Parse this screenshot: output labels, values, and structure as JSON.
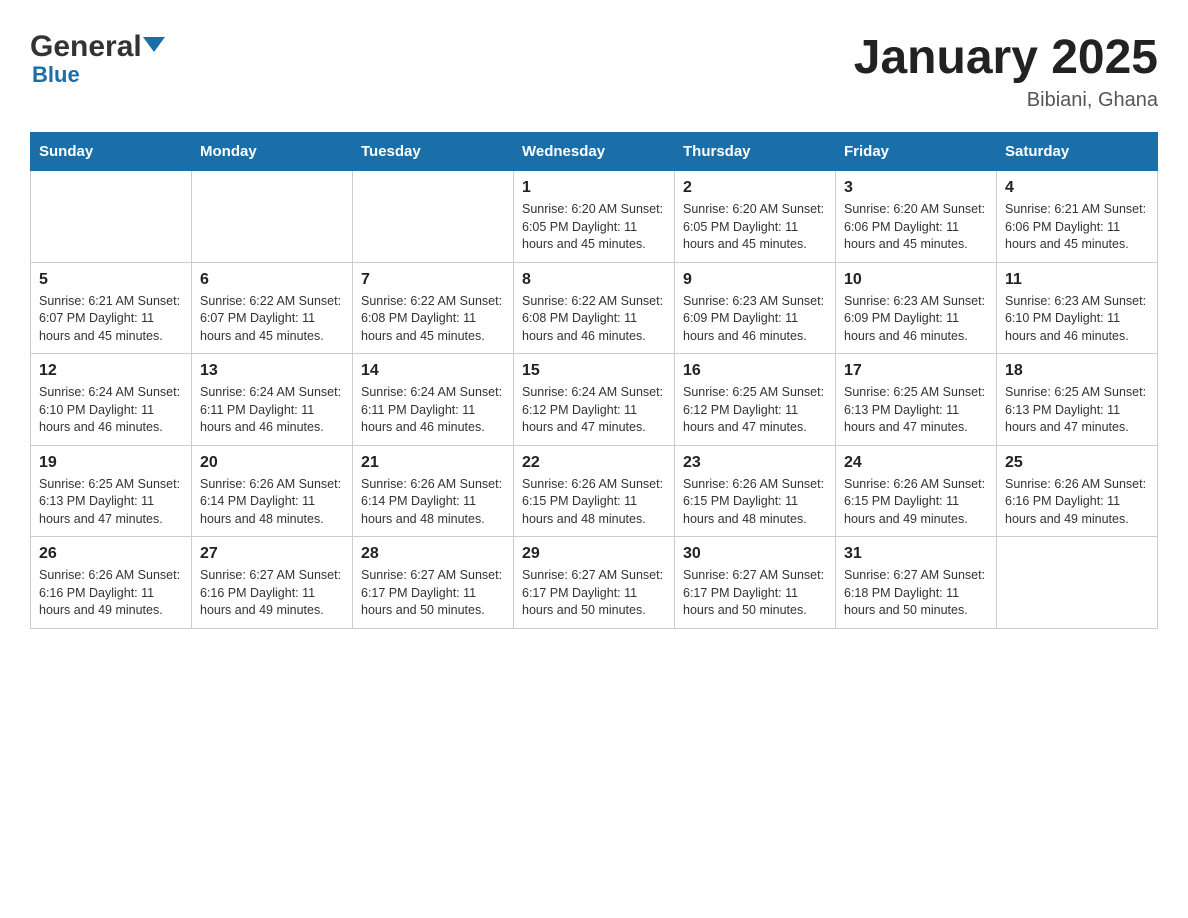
{
  "header": {
    "logo": {
      "general": "General",
      "blue": "Blue"
    },
    "title": "January 2025",
    "location": "Bibiani, Ghana"
  },
  "calendar": {
    "days_of_week": [
      "Sunday",
      "Monday",
      "Tuesday",
      "Wednesday",
      "Thursday",
      "Friday",
      "Saturday"
    ],
    "weeks": [
      [
        {
          "day": "",
          "info": ""
        },
        {
          "day": "",
          "info": ""
        },
        {
          "day": "",
          "info": ""
        },
        {
          "day": "1",
          "info": "Sunrise: 6:20 AM\nSunset: 6:05 PM\nDaylight: 11 hours and 45 minutes."
        },
        {
          "day": "2",
          "info": "Sunrise: 6:20 AM\nSunset: 6:05 PM\nDaylight: 11 hours and 45 minutes."
        },
        {
          "day": "3",
          "info": "Sunrise: 6:20 AM\nSunset: 6:06 PM\nDaylight: 11 hours and 45 minutes."
        },
        {
          "day": "4",
          "info": "Sunrise: 6:21 AM\nSunset: 6:06 PM\nDaylight: 11 hours and 45 minutes."
        }
      ],
      [
        {
          "day": "5",
          "info": "Sunrise: 6:21 AM\nSunset: 6:07 PM\nDaylight: 11 hours and 45 minutes."
        },
        {
          "day": "6",
          "info": "Sunrise: 6:22 AM\nSunset: 6:07 PM\nDaylight: 11 hours and 45 minutes."
        },
        {
          "day": "7",
          "info": "Sunrise: 6:22 AM\nSunset: 6:08 PM\nDaylight: 11 hours and 45 minutes."
        },
        {
          "day": "8",
          "info": "Sunrise: 6:22 AM\nSunset: 6:08 PM\nDaylight: 11 hours and 46 minutes."
        },
        {
          "day": "9",
          "info": "Sunrise: 6:23 AM\nSunset: 6:09 PM\nDaylight: 11 hours and 46 minutes."
        },
        {
          "day": "10",
          "info": "Sunrise: 6:23 AM\nSunset: 6:09 PM\nDaylight: 11 hours and 46 minutes."
        },
        {
          "day": "11",
          "info": "Sunrise: 6:23 AM\nSunset: 6:10 PM\nDaylight: 11 hours and 46 minutes."
        }
      ],
      [
        {
          "day": "12",
          "info": "Sunrise: 6:24 AM\nSunset: 6:10 PM\nDaylight: 11 hours and 46 minutes."
        },
        {
          "day": "13",
          "info": "Sunrise: 6:24 AM\nSunset: 6:11 PM\nDaylight: 11 hours and 46 minutes."
        },
        {
          "day": "14",
          "info": "Sunrise: 6:24 AM\nSunset: 6:11 PM\nDaylight: 11 hours and 46 minutes."
        },
        {
          "day": "15",
          "info": "Sunrise: 6:24 AM\nSunset: 6:12 PM\nDaylight: 11 hours and 47 minutes."
        },
        {
          "day": "16",
          "info": "Sunrise: 6:25 AM\nSunset: 6:12 PM\nDaylight: 11 hours and 47 minutes."
        },
        {
          "day": "17",
          "info": "Sunrise: 6:25 AM\nSunset: 6:13 PM\nDaylight: 11 hours and 47 minutes."
        },
        {
          "day": "18",
          "info": "Sunrise: 6:25 AM\nSunset: 6:13 PM\nDaylight: 11 hours and 47 minutes."
        }
      ],
      [
        {
          "day": "19",
          "info": "Sunrise: 6:25 AM\nSunset: 6:13 PM\nDaylight: 11 hours and 47 minutes."
        },
        {
          "day": "20",
          "info": "Sunrise: 6:26 AM\nSunset: 6:14 PM\nDaylight: 11 hours and 48 minutes."
        },
        {
          "day": "21",
          "info": "Sunrise: 6:26 AM\nSunset: 6:14 PM\nDaylight: 11 hours and 48 minutes."
        },
        {
          "day": "22",
          "info": "Sunrise: 6:26 AM\nSunset: 6:15 PM\nDaylight: 11 hours and 48 minutes."
        },
        {
          "day": "23",
          "info": "Sunrise: 6:26 AM\nSunset: 6:15 PM\nDaylight: 11 hours and 48 minutes."
        },
        {
          "day": "24",
          "info": "Sunrise: 6:26 AM\nSunset: 6:15 PM\nDaylight: 11 hours and 49 minutes."
        },
        {
          "day": "25",
          "info": "Sunrise: 6:26 AM\nSunset: 6:16 PM\nDaylight: 11 hours and 49 minutes."
        }
      ],
      [
        {
          "day": "26",
          "info": "Sunrise: 6:26 AM\nSunset: 6:16 PM\nDaylight: 11 hours and 49 minutes."
        },
        {
          "day": "27",
          "info": "Sunrise: 6:27 AM\nSunset: 6:16 PM\nDaylight: 11 hours and 49 minutes."
        },
        {
          "day": "28",
          "info": "Sunrise: 6:27 AM\nSunset: 6:17 PM\nDaylight: 11 hours and 50 minutes."
        },
        {
          "day": "29",
          "info": "Sunrise: 6:27 AM\nSunset: 6:17 PM\nDaylight: 11 hours and 50 minutes."
        },
        {
          "day": "30",
          "info": "Sunrise: 6:27 AM\nSunset: 6:17 PM\nDaylight: 11 hours and 50 minutes."
        },
        {
          "day": "31",
          "info": "Sunrise: 6:27 AM\nSunset: 6:18 PM\nDaylight: 11 hours and 50 minutes."
        },
        {
          "day": "",
          "info": ""
        }
      ]
    ]
  }
}
